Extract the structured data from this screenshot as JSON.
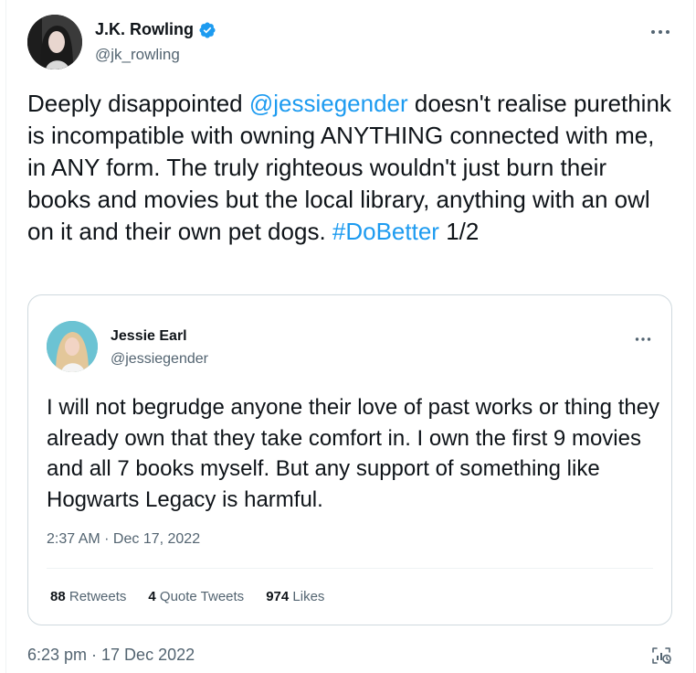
{
  "tweet": {
    "author": {
      "display_name": "J.K. Rowling",
      "handle": "@jk_rowling",
      "verified": true
    },
    "text_parts": {
      "p1": "Deeply disappointed ",
      "mention": "@jessiegender",
      "p2": " doesn't realise purethink is incompatible with owning ANYTHING connected with me, in ANY form. The truly righteous wouldn't just burn their books and movies but the local library, anything with an owl on it and their own pet dogs. ",
      "hashtag": "#DoBetter",
      "p3": " 1/2"
    },
    "more_icon": "more-horizontal-icon",
    "timestamp": "6:23 pm · 17 Dec 2022",
    "analytics_icon": "analytics-icon"
  },
  "quote": {
    "author": {
      "display_name": "Jessie Earl",
      "handle": "@jessiegender"
    },
    "text": "I will not begrudge anyone their love of past works or thing they already own that they take comfort in. I own the first 9 movies and all 7 books myself. But any support of something like Hogwarts Legacy is harmful.",
    "timestamp": "2:37 AM · Dec 17, 2022",
    "stats": {
      "retweets_count": "88",
      "retweets_label": "Retweets",
      "quotes_count": "4",
      "quotes_label": "Quote Tweets",
      "likes_count": "974",
      "likes_label": "Likes"
    }
  },
  "colors": {
    "accent": "#1d9bf0",
    "text": "#0f1419",
    "secondary": "#536471",
    "border": "#cfd9de"
  }
}
